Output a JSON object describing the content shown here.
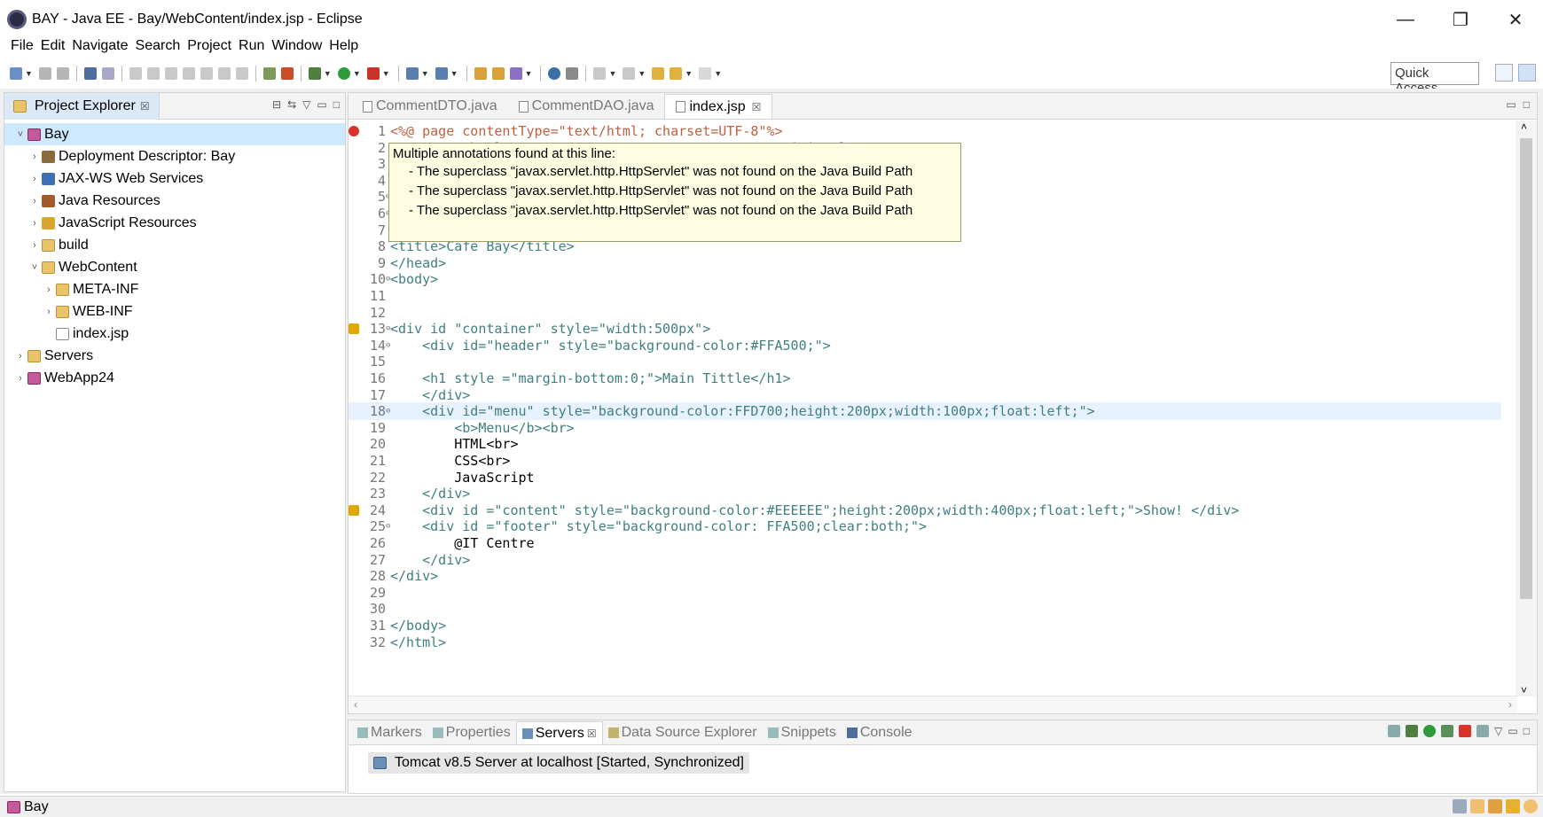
{
  "window": {
    "title": "BAY - Java EE - Bay/WebContent/index.jsp - Eclipse",
    "minimize": "—",
    "maximize": "❐",
    "close": "✕"
  },
  "menu": [
    "File",
    "Edit",
    "Navigate",
    "Search",
    "Project",
    "Run",
    "Window",
    "Help"
  ],
  "toolbar": {
    "quick_access": "Quick Access"
  },
  "project_explorer": {
    "tab_label": "Project Explorer",
    "tab_close": "☒",
    "items": [
      {
        "label": "Bay",
        "twisty": "˅",
        "icon": "project-icon",
        "selected": true
      },
      {
        "label": "Deployment Descriptor: Bay",
        "twisty": "›",
        "icon": "deployment-descriptor-icon"
      },
      {
        "label": "JAX-WS Web Services",
        "twisty": "›",
        "icon": "web-services-icon"
      },
      {
        "label": "Java Resources",
        "twisty": "›",
        "icon": "java-resources-icon"
      },
      {
        "label": "JavaScript Resources",
        "twisty": "›",
        "icon": "javascript-resources-icon"
      },
      {
        "label": "build",
        "twisty": "›",
        "icon": "folder-icon"
      },
      {
        "label": "WebContent",
        "twisty": "˅",
        "icon": "folder-icon"
      },
      {
        "label": "META-INF",
        "twisty": "›",
        "icon": "folder-icon"
      },
      {
        "label": "WEB-INF",
        "twisty": "›",
        "icon": "folder-icon"
      },
      {
        "label": "index.jsp",
        "twisty": "",
        "icon": "jsp-file-icon"
      },
      {
        "label": "Servers",
        "twisty": "›",
        "icon": "folder-icon"
      },
      {
        "label": "WebApp24",
        "twisty": "›",
        "icon": "project-icon"
      }
    ]
  },
  "editor": {
    "tabs": [
      {
        "label": "CommentDTO.java",
        "active": false
      },
      {
        "label": "CommentDAO.java",
        "active": false
      },
      {
        "label": "index.jsp",
        "active": true,
        "close": "☒"
      }
    ],
    "lines": [
      {
        "n": "1",
        "text": "<%@ page contentType=\"text/html; charset=UTF-8\"%>",
        "marker": "err",
        "fold": ""
      },
      {
        "n": "2",
        "text": "<!DOCTYPE html PUBLIC \"-//W3C//DTD HTML 4.01 Transitional//EN\">",
        "marker": "",
        "fold": ""
      },
      {
        "n": "3",
        "text": "",
        "marker": "",
        "fold": ""
      },
      {
        "n": "4",
        "text": "",
        "marker": "",
        "fold": ""
      },
      {
        "n": "5",
        "text": "",
        "marker": "",
        "fold": "⊖"
      },
      {
        "n": "6",
        "text": "",
        "marker": "",
        "fold": "⊖"
      },
      {
        "n": "7",
        "text": "<meta http-equiv=\"Content-Type\" content=\"text/html; charset=EUC-KR\">",
        "marker": "",
        "fold": ""
      },
      {
        "n": "8",
        "text": "<title>Cafe Bay</title>",
        "marker": "",
        "fold": ""
      },
      {
        "n": "9",
        "text": "</head>",
        "marker": "",
        "fold": ""
      },
      {
        "n": "10",
        "text": "<body>",
        "marker": "",
        "fold": "⊖"
      },
      {
        "n": "11",
        "text": "",
        "marker": "",
        "fold": ""
      },
      {
        "n": "12",
        "text": "",
        "marker": "",
        "fold": ""
      },
      {
        "n": "13",
        "text": "<div id \"container\" style=\"width:500px\">",
        "marker": "warn",
        "fold": "⊖"
      },
      {
        "n": "14",
        "text": "    <div id=\"header\" style=\"background-color:#FFA500;\">",
        "marker": "",
        "fold": "⊖"
      },
      {
        "n": "15",
        "text": "",
        "marker": "",
        "fold": ""
      },
      {
        "n": "16",
        "text": "    <h1 style =\"margin-bottom:0;\">Main Tittle</h1>",
        "marker": "",
        "fold": ""
      },
      {
        "n": "17",
        "text": "    </div>",
        "marker": "",
        "fold": ""
      },
      {
        "n": "18",
        "text": "    <div id=\"menu\" style=\"background-color:FFD700;height:200px;width:100px;float:left;\">",
        "marker": "",
        "fold": "⊖",
        "current": true
      },
      {
        "n": "19",
        "text": "        <b>Menu</b><br>",
        "marker": "",
        "fold": ""
      },
      {
        "n": "20",
        "text": "        HTML<br>",
        "marker": "",
        "fold": ""
      },
      {
        "n": "21",
        "text": "        CSS<br>",
        "marker": "",
        "fold": ""
      },
      {
        "n": "22",
        "text": "        JavaScript",
        "marker": "",
        "fold": ""
      },
      {
        "n": "23",
        "text": "    </div>",
        "marker": "",
        "fold": ""
      },
      {
        "n": "24",
        "text": "    <div id =\"content\" style=\"background-color:#EEEEEE\";height:200px;width:400px;float:left;\">Show! </div>",
        "marker": "warn",
        "fold": ""
      },
      {
        "n": "25",
        "text": "    <div id =\"footer\" style=\"background-color: FFA500;clear:both;\">",
        "marker": "",
        "fold": "⊖"
      },
      {
        "n": "26",
        "text": "        @IT Centre",
        "marker": "",
        "fold": ""
      },
      {
        "n": "27",
        "text": "    </div>",
        "marker": "",
        "fold": ""
      },
      {
        "n": "28",
        "text": "</div>",
        "marker": "",
        "fold": ""
      },
      {
        "n": "29",
        "text": "",
        "marker": "",
        "fold": ""
      },
      {
        "n": "30",
        "text": "",
        "marker": "",
        "fold": ""
      },
      {
        "n": "31",
        "text": "</body>",
        "marker": "",
        "fold": ""
      },
      {
        "n": "32",
        "text": "</html>",
        "marker": "",
        "fold": ""
      }
    ],
    "scroll_left": "‹",
    "scroll_right": "›",
    "scroll_up": "˄",
    "scroll_down": "˅"
  },
  "tooltip": {
    "heading": "Multiple annotations found at this line:",
    "items": [
      "- The superclass \"javax.servlet.http.HttpServlet\" was not found on the Java Build Path",
      "- The superclass \"javax.servlet.http.HttpServlet\" was not found on the Java Build Path",
      "- The superclass \"javax.servlet.http.HttpServlet\" was not found on the Java Build Path"
    ]
  },
  "bottom_panel": {
    "tabs": [
      {
        "label": "Markers",
        "active": false
      },
      {
        "label": "Properties",
        "active": false
      },
      {
        "label": "Servers",
        "active": true
      },
      {
        "label": "Data Source Explorer",
        "active": false
      },
      {
        "label": "Snippets",
        "active": false
      },
      {
        "label": "Console",
        "active": false
      }
    ],
    "server_entry": "Tomcat v8.5 Server at localhost  [Started, Synchronized]"
  },
  "status": {
    "selection": "Bay"
  },
  "colors": {
    "tag": "#3f7f7f",
    "attr_name": "#7f007f",
    "attr_value": "#2a00ff",
    "directive": "#bf5f3f",
    "error": "#d9342b",
    "warning": "#e0a800",
    "current_line": "#e8f2fe"
  }
}
